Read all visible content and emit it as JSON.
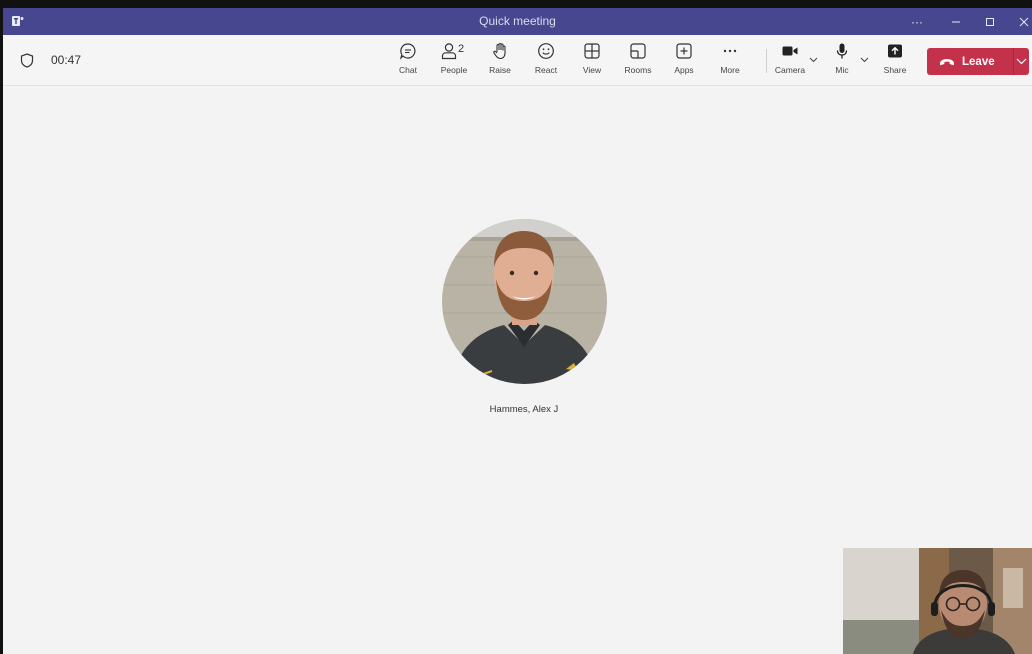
{
  "window": {
    "title": "Quick meeting",
    "more_icon": "ellipsis-icon",
    "controls": [
      "minimize-icon",
      "maximize-icon",
      "close-icon"
    ]
  },
  "toolbar": {
    "timer": "00:47",
    "buttons": {
      "chat": "Chat",
      "people": "People",
      "people_count": "2",
      "raise": "Raise",
      "react": "React",
      "view": "View",
      "rooms": "Rooms",
      "apps": "Apps",
      "more": "More",
      "camera": "Camera",
      "mic": "Mic",
      "share": "Share"
    },
    "leave": "Leave"
  },
  "stage": {
    "participant_name": "Hammes, Alex J"
  },
  "colors": {
    "titlebar": "#47478f",
    "stage_bg": "#f3f3f3",
    "leave_button": "#c4314b"
  }
}
